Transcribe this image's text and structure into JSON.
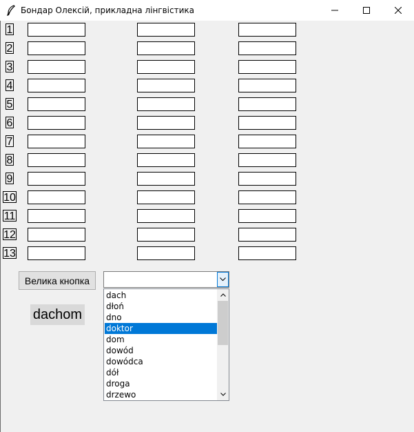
{
  "window": {
    "title": "Бондар Олексій, прикладна лінгвістика",
    "icon": "feather-icon"
  },
  "rows": [
    {
      "number": "1"
    },
    {
      "number": "2"
    },
    {
      "number": "3"
    },
    {
      "number": "4"
    },
    {
      "number": "5"
    },
    {
      "number": "6"
    },
    {
      "number": "7"
    },
    {
      "number": "8"
    },
    {
      "number": "9"
    },
    {
      "number": "10"
    },
    {
      "number": "11"
    },
    {
      "number": "12"
    },
    {
      "number": "13"
    }
  ],
  "big_button": {
    "label": "Велика кнопка"
  },
  "result": {
    "text": "dachom"
  },
  "combobox": {
    "value": "",
    "options": [
      "dach",
      "dłoń",
      "dno",
      "doktor",
      "dom",
      "dowód",
      "dowódca",
      "dół",
      "droga",
      "drzewo"
    ],
    "selected": "doktor"
  },
  "colors": {
    "selection": "#0078d7",
    "window_bg": "#f0f0f0"
  }
}
